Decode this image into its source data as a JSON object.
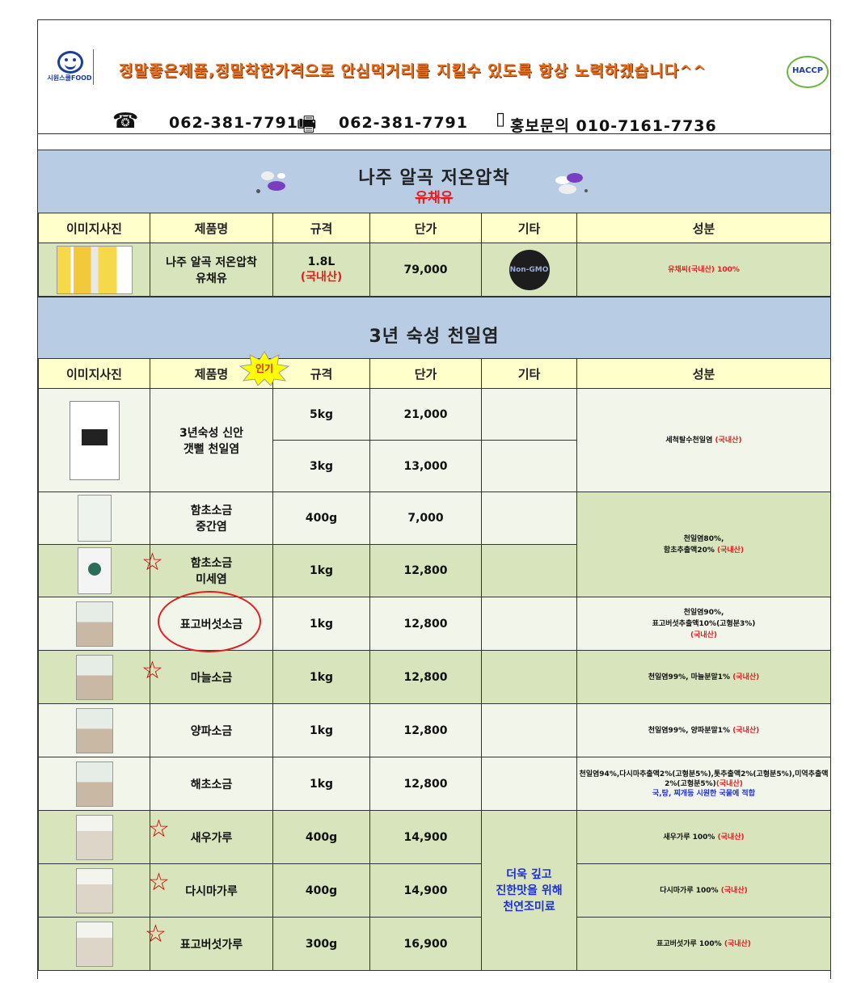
{
  "header": {
    "logo_text": "시원스쿨FOOD",
    "slogan": "정말좋은제품,정말착한가격으로 안심먹거리를 지킬수 있도록 항상 노력하겠습니다^^",
    "haccp_text": "HACCP",
    "phone": "062-381-7791",
    "fax": "062-381-7791",
    "mobile_label": "홍보문의 010-7161-7736"
  },
  "section1": {
    "title": "나주 알곡 저온압착",
    "subtitle": "유채유"
  },
  "section2": {
    "title": "3년 숙성 천일염",
    "badge": "인기"
  },
  "columns": [
    "이미지사진",
    "제품명",
    "규격",
    "단가",
    "기타",
    "성분"
  ],
  "oil": {
    "name1": "나주 알곡 저온압착",
    "name2": "유채유",
    "spec": "1.8L",
    "origin": "(국내산)",
    "price": "79,000",
    "etc": "Non-GMO",
    "ing": "유채씨(국내산) 100%"
  },
  "salt": {
    "r1": {
      "name1": "3년숙성 신안",
      "name2": "갯뻘 천일염",
      "spec_a": "5kg",
      "price_a": "21,000",
      "spec_b": "3kg",
      "price_b": "13,000",
      "ing_a": "세척탈수천일염 ",
      "ing_b": "(국내산)"
    },
    "r2": {
      "name1": "함초소금",
      "name2": "중간염",
      "spec": "400g",
      "price": "7,000"
    },
    "r3": {
      "name1": "함초소금",
      "name2": "미세염",
      "spec": "1kg",
      "price": "12,800"
    },
    "r23_ing": {
      "a": "천일염80%,",
      "b": "함초추출액20% ",
      "c": "(국내산)"
    },
    "r4": {
      "name": "표고버섯소금",
      "spec": "1kg",
      "price": "12,800",
      "ing_a": "천일염90%,",
      "ing_b": "표고버섯추출액10%(고형분3%)",
      "ing_c": "(국내산)"
    },
    "r5": {
      "name": "마늘소금",
      "spec": "1kg",
      "price": "12,800",
      "ing_a": "천일염99%, 마늘분말1% ",
      "ing_b": "(국내산)"
    },
    "r6": {
      "name": "양파소금",
      "spec": "1kg",
      "price": "12,800",
      "ing_a": "천일염99%, 양파분말1% ",
      "ing_b": "(국내산)"
    },
    "r7": {
      "name": "해초소금",
      "spec": "1kg",
      "price": "12,800",
      "ing_a": "천일염94%,다시마추출액2%(고형분5%),톳추출액2%(고형분5%),미역추출액2%(고형분5%)",
      "ing_b": "(국내산)",
      "ing_c": "국,탕, 찌개등 시원한 국물에 적합"
    },
    "r8": {
      "name": "새우가루",
      "spec": "400g",
      "price": "14,900",
      "ing_a": "새우가루 100% ",
      "ing_b": "(국내산)"
    },
    "r9": {
      "name": "다시마가루",
      "spec": "400g",
      "price": "14,900",
      "ing_a": "다시마가루 100% ",
      "ing_b": "(국내산)"
    },
    "r10": {
      "name": "표고버섯가루",
      "spec": "300g",
      "price": "16,900",
      "ing_a": "표고버섯가루 100% ",
      "ing_b": "(국내산)"
    },
    "etc_note": {
      "a": "더욱 깊고",
      "b": "진한맛을 위해",
      "c": "천연조미료"
    }
  }
}
